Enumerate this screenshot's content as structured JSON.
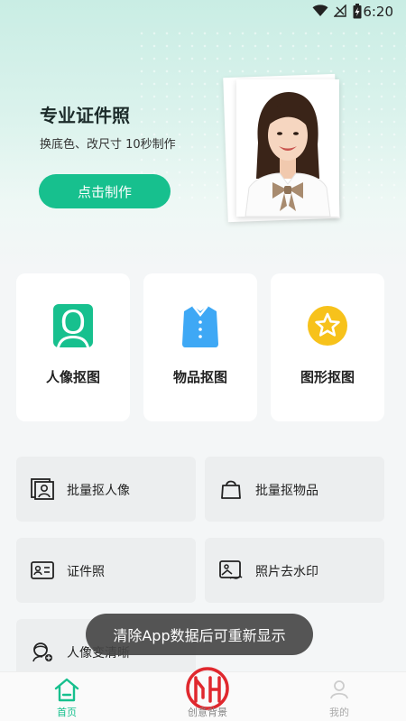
{
  "status_bar": {
    "time": "6:20"
  },
  "hero": {
    "title": "专业证件照",
    "subtitle": "换底色、改尺寸 10秒制作",
    "button_label": "点击制作"
  },
  "big_cards": [
    {
      "label": "人像抠图",
      "icon": "person-icon",
      "color": "#17c08e"
    },
    {
      "label": "物品抠图",
      "icon": "shirt-icon",
      "color": "#3ea8f5"
    },
    {
      "label": "图形抠图",
      "icon": "star-icon",
      "color": "#f7c21b"
    }
  ],
  "small_cards": [
    {
      "label": "批量抠人像",
      "icon": "portrait-frame-icon"
    },
    {
      "label": "批量抠物品",
      "icon": "bag-icon"
    },
    {
      "label": "证件照",
      "icon": "id-card-icon"
    },
    {
      "label": "照片去水印",
      "icon": "image-watermark-icon"
    },
    {
      "label": "人像变清晰",
      "icon": "face-enhance-icon"
    }
  ],
  "toast": {
    "text": "清除App数据后可重新显示"
  },
  "bottom_nav": {
    "home_label": "首页",
    "center_label": "创意背景",
    "right_label": "我的"
  },
  "colors": {
    "accent": "#17c08e",
    "card_bg": "#ffffff",
    "tile_bg": "#eceeef"
  }
}
